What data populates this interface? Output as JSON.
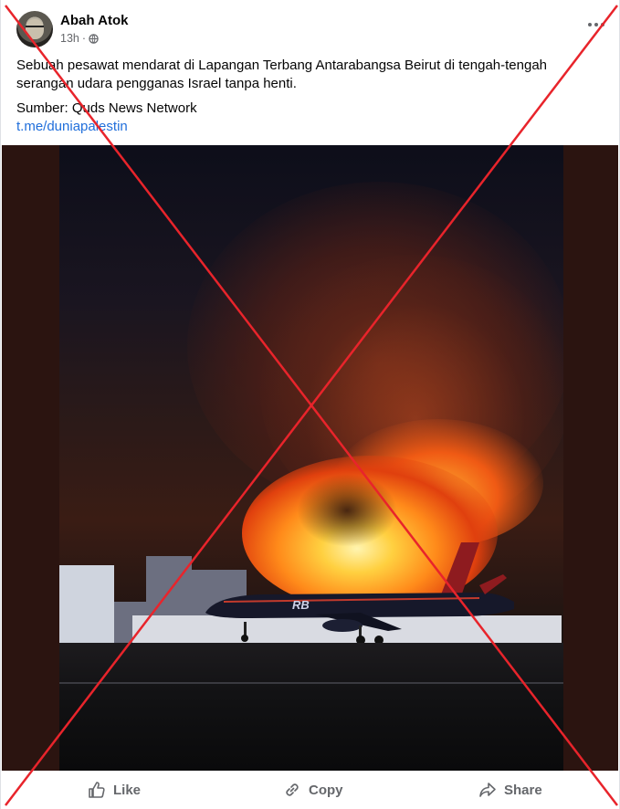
{
  "post": {
    "author": "Abah Atok",
    "time": "13h",
    "time_separator": "·",
    "privacy_icon": "globe-icon",
    "more_icon": "more-options-icon",
    "text": "Sebuah pesawat mendarat di Lapangan Terbang Antarabangsa Beirut di tengah-tengah serangan udara pengganas Israel tanpa henti.",
    "source": "Sumber: Quds News Network",
    "link": "t.me/duniapalestin"
  },
  "image": {
    "plane_livery": "RB"
  },
  "overlay": {
    "type": "red-x-mark",
    "color": "#e8242b"
  },
  "actions": {
    "like": "Like",
    "copy": "Copy",
    "share": "Share"
  }
}
